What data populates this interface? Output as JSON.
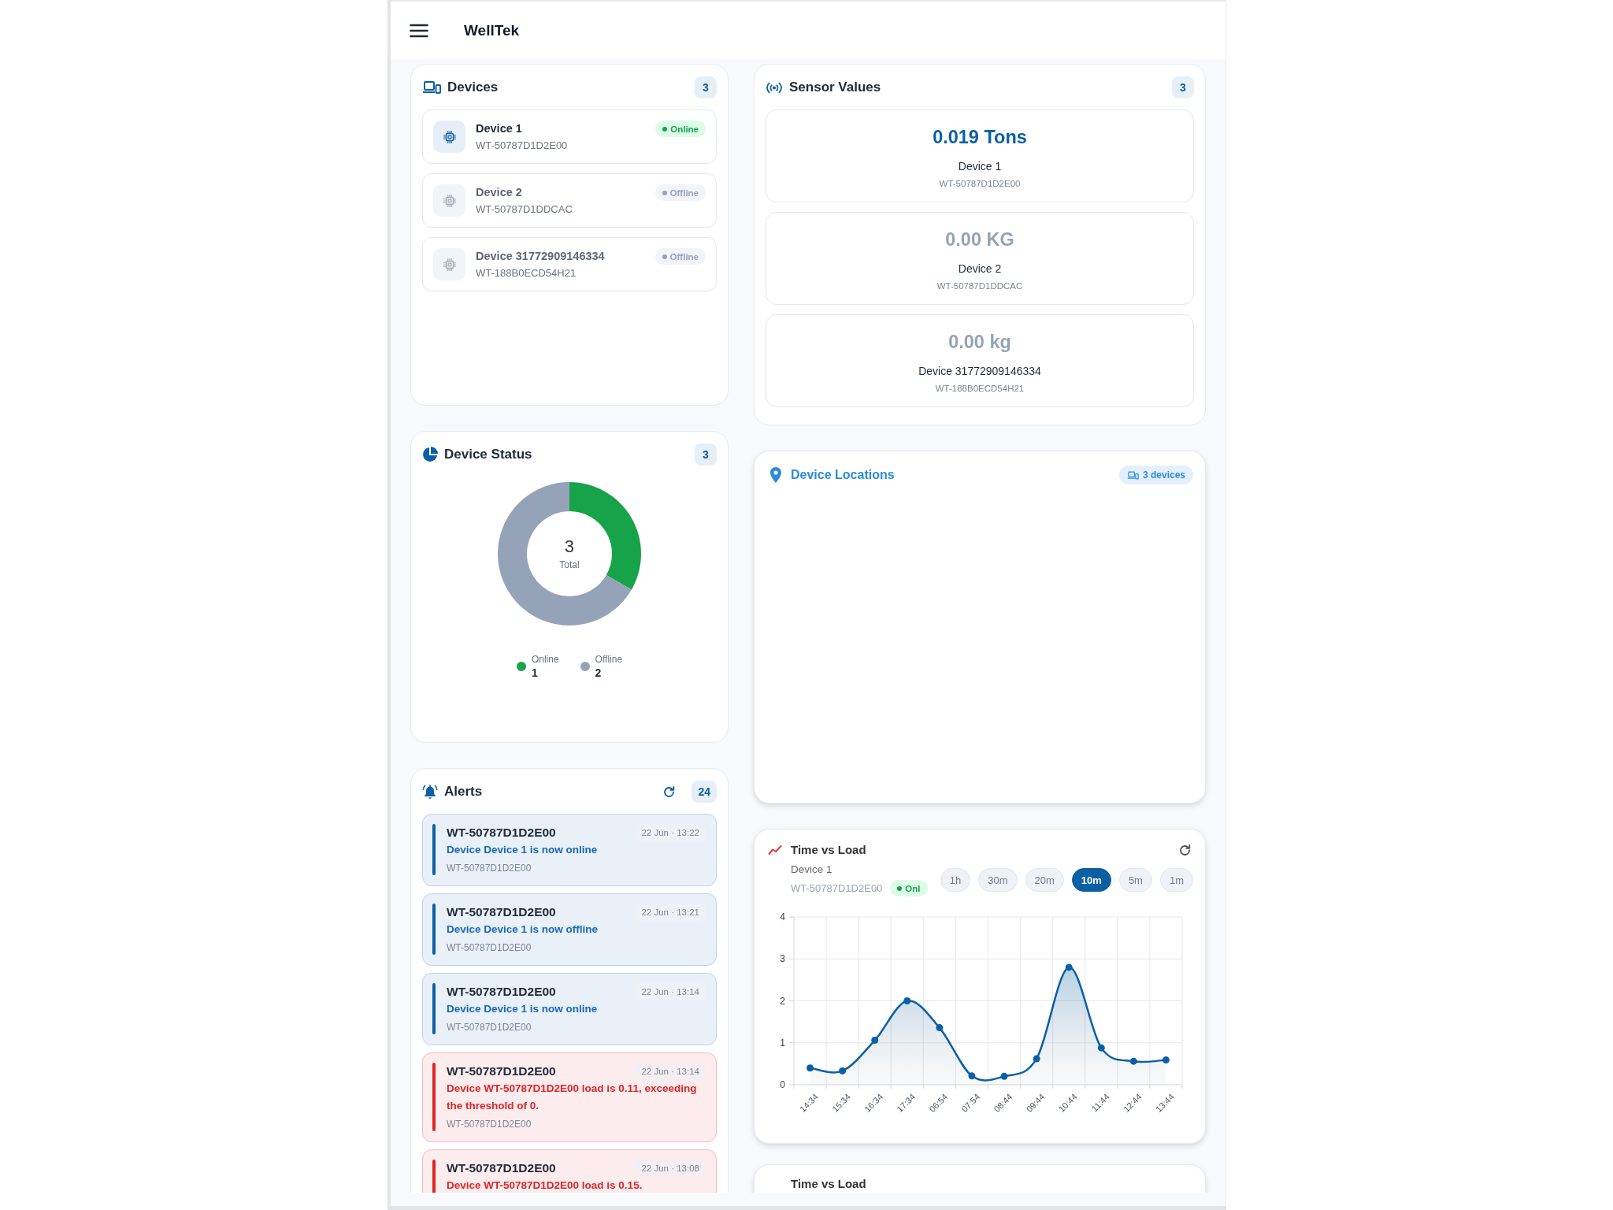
{
  "app": {
    "title": "WellTek"
  },
  "devices": {
    "title": "Devices",
    "count": "3",
    "items": [
      {
        "name": "Device 1",
        "serial": "WT-50787D1D2E00",
        "status": "Online",
        "online": true
      },
      {
        "name": "Device 2",
        "serial": "WT-50787D1DDCAC",
        "status": "Offline",
        "online": false
      },
      {
        "name": "Device 31772909146334",
        "serial": "WT-188B0ECD54H21",
        "status": "Offline",
        "online": false
      }
    ]
  },
  "sensor_values": {
    "title": "Sensor Values",
    "count": "3",
    "items": [
      {
        "value": "0.019 Tons",
        "device": "Device 1",
        "serial": "WT-50787D1D2E00",
        "online": true
      },
      {
        "value": "0.00 KG",
        "device": "Device 2",
        "serial": "WT-50787D1DDCAC",
        "online": false
      },
      {
        "value": "0.00 kg",
        "device": "Device 31772909146334",
        "serial": "WT-188B0ECD54H21",
        "online": false
      }
    ]
  },
  "device_status": {
    "title": "Device Status",
    "count": "3",
    "total": "3",
    "total_label": "Total",
    "chart_data": {
      "type": "donut",
      "values": [
        33.33,
        66.67
      ]
    },
    "legend": [
      {
        "label": "Online",
        "count": "1",
        "color": "#16a34a"
      },
      {
        "label": "Offline",
        "count": "2",
        "color": "#94a3b8"
      }
    ]
  },
  "device_locations": {
    "title": "Device Locations",
    "badge": "3 devices"
  },
  "alerts": {
    "title": "Alerts",
    "count": "24",
    "items": [
      {
        "kind": "info",
        "device": "WT-50787D1D2E00",
        "time": "22 Jun · 13:22",
        "message": "Device Device 1 is now online",
        "serial": "WT-50787D1D2E00"
      },
      {
        "kind": "info",
        "device": "WT-50787D1D2E00",
        "time": "22 Jun · 13:21",
        "message": "Device Device 1 is now offline",
        "serial": "WT-50787D1D2E00"
      },
      {
        "kind": "info",
        "device": "WT-50787D1D2E00",
        "time": "22 Jun · 13:14",
        "message": "Device Device 1 is now online",
        "serial": "WT-50787D1D2E00"
      },
      {
        "kind": "error",
        "device": "WT-50787D1D2E00",
        "time": "22 Jun · 13:14",
        "message": "Device WT-50787D1D2E00 load is 0.11, exceeding the threshold of 0.",
        "serial": "WT-50787D1D2E00"
      },
      {
        "kind": "error",
        "device": "WT-50787D1D2E00",
        "time": "22 Jun · 13:08",
        "message": "Device WT-50787D1D2E00 load is 0.15."
      }
    ]
  },
  "load_charts": [
    {
      "kind": "chart",
      "title": "Time vs Load",
      "device": "Device 1",
      "serial": "WT-50787D1D2E00",
      "status": "Onl",
      "online": true,
      "ranges": [
        {
          "label": "1h",
          "selected": false
        },
        {
          "label": "30m",
          "selected": false
        },
        {
          "label": "20m",
          "selected": false
        },
        {
          "label": "10m",
          "selected": true
        },
        {
          "label": "5m",
          "selected": false
        },
        {
          "label": "1m",
          "selected": false
        }
      ],
      "chart_data": {
        "type": "area",
        "categories": [
          "14:34",
          "15:34",
          "16:34",
          "17:34",
          "06:54",
          "07:54",
          "08:44",
          "09:44",
          "10:44",
          "11:44",
          "12:44",
          "13:44"
        ],
        "series": [
          {
            "color": "#0b5fa5",
            "values": [
              0.4,
              0.33,
              1.06,
              2.0,
              1.36,
              0.21,
              0.2,
              0.62,
              2.8,
              0.88,
              0.56,
              0.59
            ]
          }
        ],
        "ylim": [
          0,
          4
        ],
        "yticks": [
          0,
          1,
          2,
          3,
          4
        ],
        "grid": true
      }
    },
    {
      "kind": "loading",
      "title": "Time vs Load"
    }
  ]
}
